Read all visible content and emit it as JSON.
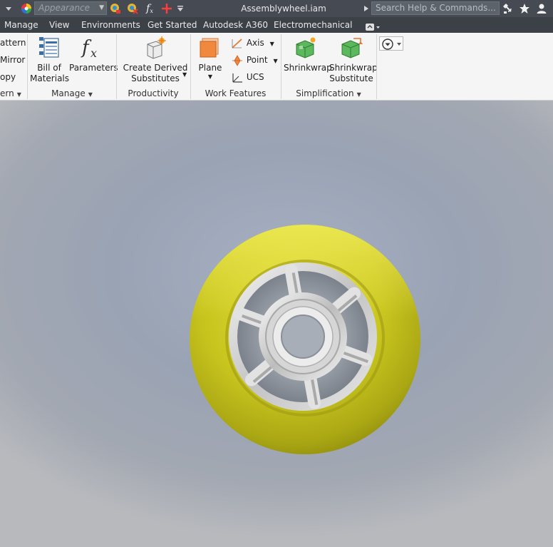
{
  "titlebar": {
    "appearance_placeholder": "Appearance",
    "document_title": "Assemblywheel.iam",
    "search_placeholder": "Search Help & Commands...",
    "fx_label": "f",
    "fx_sub": "x"
  },
  "tabs": [
    "Manage",
    "View",
    "Environments",
    "Get Started",
    "Autodesk A360",
    "Electromechanical"
  ],
  "ribbon": {
    "pattern_group": {
      "items": [
        "attern",
        "Mirror",
        "opy"
      ],
      "label": "ern"
    },
    "manage_group": {
      "bill_of_materials": [
        "Bill of",
        "Materials"
      ],
      "parameters": "Parameters",
      "label": "Manage"
    },
    "productivity_group": {
      "create_derived": [
        "Create Derived",
        "Substitutes"
      ],
      "label": "Productivity"
    },
    "work_features_group": {
      "plane": "Plane",
      "axis": "Axis",
      "point": "Point",
      "ucs": "UCS",
      "label": "Work Features"
    },
    "simplification_group": {
      "shrinkwrap": "Shrinkwrap",
      "shrinkwrap_substitute": [
        "Shrinkwrap",
        "Substitute"
      ],
      "label": "Simplification"
    }
  },
  "colors": {
    "tire": "#c6c21e",
    "hub": "#d8d8d8",
    "titlebar": "#454a53",
    "tabrow": "#3c4047"
  }
}
